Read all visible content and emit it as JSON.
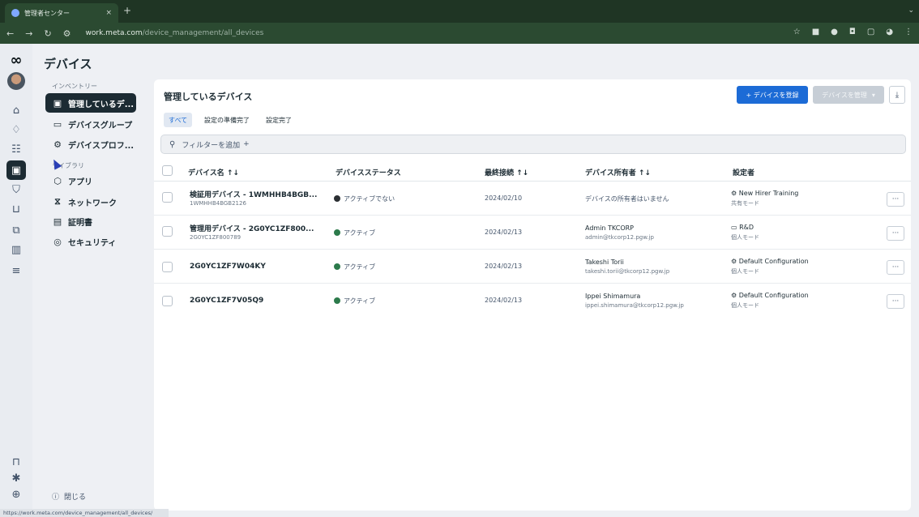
{
  "browser": {
    "tab_title": "管理者センター",
    "tab_close": "×",
    "new_tab": "+",
    "url_host": "work.meta.com",
    "url_path": "/device_management/all_devices",
    "status_url": "https://work.meta.com/device_management/all_devices/"
  },
  "page": {
    "title": "デバイス"
  },
  "sidebar": {
    "inventory_label": "インベントリー",
    "library_label": "ライブラリ",
    "items": [
      {
        "label": "管理しているデ...",
        "icon": "headset-icon"
      },
      {
        "label": "デバイスグループ",
        "icon": "folder-icon"
      },
      {
        "label": "デバイスプロフ...",
        "icon": "config-icon"
      },
      {
        "label": "アプリ",
        "icon": "cube-icon"
      },
      {
        "label": "ネットワーク",
        "icon": "network-icon"
      },
      {
        "label": "証明書",
        "icon": "certificate-icon"
      },
      {
        "label": "セキュリティ",
        "icon": "shield-icon"
      }
    ],
    "close_label": "閉じる"
  },
  "panel": {
    "title": "管理しているデバイス",
    "register_button": "+ デバイスを登録",
    "manage_button": "デバイスを管理",
    "tabs": [
      "すべて",
      "設定の準備完了",
      "設定完了"
    ],
    "filter_label": "フィルターを追加",
    "filter_plus": "+"
  },
  "table": {
    "columns": [
      "デバイス名 ↑↓",
      "デバイスステータス",
      "最終接続 ↑↓",
      "デバイス所有者 ↑↓",
      "設定者"
    ],
    "rows": [
      {
        "name": "検証用デバイス - 1WMHHB4BGB...",
        "serial": "1WMHHB4BGB2126",
        "status": "アクティブでない",
        "status_kind": "inactive",
        "last": "2024/02/10",
        "owner": "デバイスの所有者はいません",
        "owner_email": "",
        "config": "New Hirer Training",
        "config_icon": "config-icon",
        "mode": "共有モード",
        "more": "···"
      },
      {
        "name": "管理用デバイス - 2G0YC1ZF800...",
        "serial": "2G0YC1ZF800789",
        "status": "アクティブ",
        "status_kind": "active",
        "last": "2024/02/13",
        "owner": "Admin TKCORP",
        "owner_email": "admin@tkcorp12.pgw.jp",
        "config": "R&D",
        "config_icon": "folder-icon",
        "mode": "個人モード",
        "more": "···"
      },
      {
        "name": "2G0YC1ZF7W04KY",
        "serial": "",
        "status": "アクティブ",
        "status_kind": "active",
        "last": "2024/02/13",
        "owner": "Takeshi Torii",
        "owner_email": "takeshi.torii@tkcorp12.pgw.jp",
        "config": "Default Configuration",
        "config_icon": "config-icon",
        "mode": "個人モード",
        "more": "···"
      },
      {
        "name": "2G0YC1ZF7V05Q9",
        "serial": "",
        "status": "アクティブ",
        "status_kind": "active",
        "last": "2024/02/13",
        "owner": "Ippei Shimamura",
        "owner_email": "ippei.shimamura@tkcorp12.pgw.jp",
        "config": "Default Configuration",
        "config_icon": "config-icon",
        "mode": "個人モード",
        "more": "···"
      }
    ]
  },
  "colors": {
    "primary": "#1c6bd6",
    "active_status": "#2c7a4b",
    "nav_active": "#1c2b33",
    "chrome": "#2b4a31"
  }
}
